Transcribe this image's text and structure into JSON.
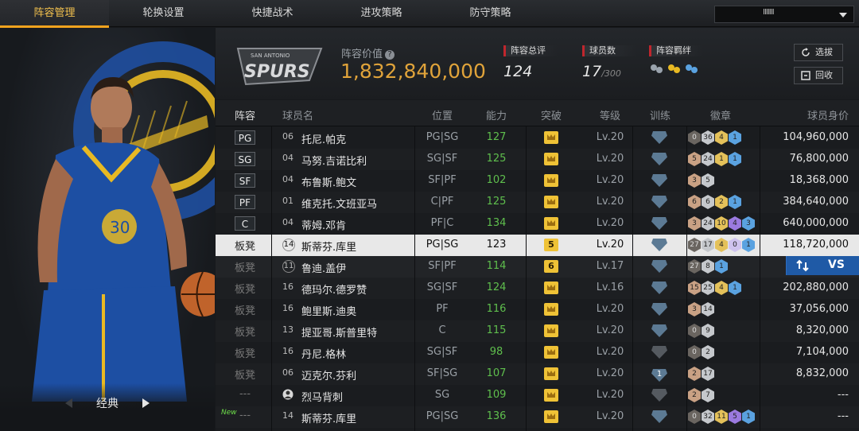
{
  "nav": {
    "tabs": [
      "阵容管理",
      "轮换设置",
      "快捷战术",
      "进攻策略",
      "防守策略"
    ],
    "active_index": 0,
    "select_value": "IIIIIII"
  },
  "card": {
    "label": "经典"
  },
  "team": {
    "logo_text": "SPURS",
    "logo_subtext": "SAN ANTONIO",
    "value_label": "阵容价值",
    "value": "1,832,840,000"
  },
  "stats": {
    "rating_label": "阵容总评",
    "rating": "124",
    "players_label": "球员数",
    "players": "17",
    "players_max": "/300",
    "bond_label": "阵容羁绊"
  },
  "buttons": {
    "pick": "选拔",
    "recycle": "回收"
  },
  "headers": {
    "lineup": "阵容",
    "name": "球员名",
    "position": "位置",
    "ability": "能力",
    "breakthrough": "突破",
    "level": "等级",
    "training": "训练",
    "badges": "徽章",
    "price": "球员身价"
  },
  "rows": [
    {
      "slot": "PG",
      "num": "06",
      "name": "托尼.帕克",
      "pos": "PG|SG",
      "ab": "127",
      "br": "",
      "lv": "Lv.20",
      "tr": "",
      "badges": [
        [
          "dark",
          "0"
        ],
        [
          "silver",
          "36"
        ],
        [
          "gold",
          "4"
        ],
        [
          "blue",
          "1"
        ]
      ],
      "price": "104,960,000"
    },
    {
      "slot": "SG",
      "num": "04",
      "name": "马努.吉诺比利",
      "pos": "SG|SF",
      "ab": "125",
      "br": "",
      "lv": "Lv.20",
      "tr": "",
      "badges": [
        [
          "bronze",
          "5"
        ],
        [
          "silver",
          "24"
        ],
        [
          "gold",
          "1"
        ],
        [
          "blue",
          "1"
        ]
      ],
      "price": "76,800,000"
    },
    {
      "slot": "SF",
      "num": "04",
      "name": "布鲁斯.鲍文",
      "pos": "SF|PF",
      "ab": "102",
      "br": "",
      "lv": "Lv.20",
      "tr": "",
      "badges": [
        [
          "bronze",
          "3"
        ],
        [
          "silver",
          "5"
        ]
      ],
      "price": "18,368,000"
    },
    {
      "slot": "PF",
      "num": "01",
      "name": "维克托.文班亚马",
      "pos": "C|PF",
      "ab": "125",
      "br": "",
      "lv": "Lv.20",
      "tr": "",
      "badges": [
        [
          "bronze",
          "6"
        ],
        [
          "silver",
          "6"
        ],
        [
          "gold",
          "2"
        ],
        [
          "blue",
          "1"
        ]
      ],
      "price": "384,640,000"
    },
    {
      "slot": "C",
      "num": "04",
      "name": "蒂姆.邓肯",
      "pos": "PF|C",
      "ab": "134",
      "br": "",
      "lv": "Lv.20",
      "tr": "",
      "badges": [
        [
          "bronze",
          "3"
        ],
        [
          "silver",
          "24"
        ],
        [
          "gold",
          "10"
        ],
        [
          "purple",
          "4"
        ],
        [
          "blue",
          "3"
        ]
      ],
      "price": "640,000,000"
    },
    {
      "slot": "板凳",
      "num": "14",
      "name": "斯蒂芬.库里",
      "pos": "PG|SG",
      "ab": "123",
      "br": "5",
      "lv": "Lv.20",
      "tr": "",
      "badges": [
        [
          "dark",
          "27"
        ],
        [
          "silver",
          "17"
        ],
        [
          "gold",
          "4"
        ],
        [
          "lav",
          "0"
        ],
        [
          "blue",
          "1"
        ]
      ],
      "price": "118,720,000"
    },
    {
      "slot": "板凳",
      "num": "11",
      "name": "鲁迪.盖伊",
      "pos": "SF|PF",
      "ab": "114",
      "br": "6",
      "lv": "Lv.17",
      "tr": "",
      "badges": [
        [
          "dark",
          "27"
        ],
        [
          "silver",
          "8"
        ],
        [
          "blue",
          "1"
        ]
      ],
      "price": ""
    },
    {
      "slot": "板凳",
      "num": "16",
      "name": "德玛尔.德罗赞",
      "pos": "SG|SF",
      "ab": "124",
      "br": "",
      "lv": "Lv.16",
      "tr": "",
      "badges": [
        [
          "bronze",
          "15"
        ],
        [
          "silver",
          "25"
        ],
        [
          "gold",
          "4"
        ],
        [
          "blue",
          "1"
        ]
      ],
      "price": "202,880,000"
    },
    {
      "slot": "板凳",
      "num": "16",
      "name": "鲍里斯.迪奥",
      "pos": "PF",
      "ab": "116",
      "br": "",
      "lv": "Lv.20",
      "tr": "",
      "badges": [
        [
          "bronze",
          "3"
        ],
        [
          "silver",
          "14"
        ]
      ],
      "price": "37,056,000"
    },
    {
      "slot": "板凳",
      "num": "13",
      "name": "提亚哥.斯普里特",
      "pos": "C",
      "ab": "115",
      "br": "",
      "lv": "Lv.20",
      "tr": "",
      "badges": [
        [
          "dark",
          "0"
        ],
        [
          "silver",
          "9"
        ]
      ],
      "price": "8,320,000"
    },
    {
      "slot": "板凳",
      "num": "16",
      "name": "丹尼.格林",
      "pos": "SG|SF",
      "ab": "98",
      "br": "",
      "lv": "Lv.20",
      "tr": "grey",
      "badges": [
        [
          "dark",
          "0"
        ],
        [
          "silver",
          "2"
        ]
      ],
      "price": "7,104,000"
    },
    {
      "slot": "板凳",
      "num": "06",
      "name": "迈克尔.芬利",
      "pos": "SF|SG",
      "ab": "107",
      "br": "",
      "lv": "Lv.20",
      "tr": "1",
      "badges": [
        [
          "bronze",
          "2"
        ],
        [
          "silver",
          "17"
        ]
      ],
      "price": "8,832,000"
    },
    {
      "slot": "---",
      "num": "",
      "name": "烈马背刺",
      "pos": "SG",
      "ab": "109",
      "br": "",
      "lv": "Lv.20",
      "tr": "grey",
      "badges": [
        [
          "bronze",
          "2"
        ],
        [
          "silver",
          "7"
        ]
      ],
      "price": "---"
    },
    {
      "slot": "---",
      "num": "14",
      "name": "斯蒂芬.库里",
      "pos": "PG|SG",
      "ab": "136",
      "br": "",
      "lv": "Lv.20",
      "tr": "",
      "badges": [
        [
          "dark",
          "0"
        ],
        [
          "silver",
          "32"
        ],
        [
          "gold",
          "11"
        ],
        [
          "purple",
          "5"
        ],
        [
          "blue",
          "1"
        ]
      ],
      "price": "---",
      "new": "New"
    }
  ],
  "vs_label": "VS",
  "colors": {
    "accent": "#f2a31e",
    "value": "#e0a33a",
    "ability": "#5fbf4d",
    "stat_marker": "#c0262d",
    "vs_bg": "#1f5aa6"
  }
}
